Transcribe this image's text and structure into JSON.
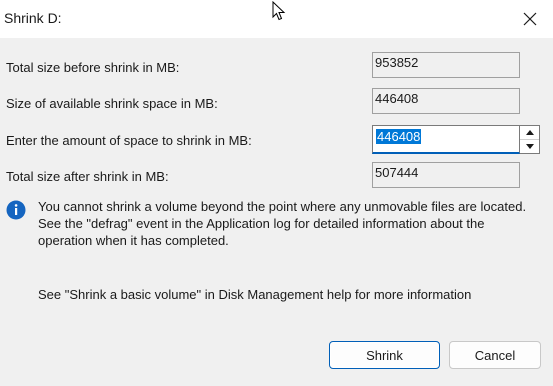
{
  "dialog": {
    "title": "Shrink D:"
  },
  "icons": {
    "close": "close-icon",
    "info": "info-icon",
    "cursor": "mouse-pointer-icon",
    "spin_up": "chevron-up-icon",
    "spin_down": "chevron-down-icon"
  },
  "fields": {
    "total_before": {
      "label": "Total size before shrink in MB:",
      "value": "953852"
    },
    "available_shrink": {
      "label": "Size of available shrink space in MB:",
      "value": "446408"
    },
    "amount_to_shrink": {
      "label": "Enter the amount of space to shrink in MB:",
      "value": "446408"
    },
    "total_after": {
      "label": "Total size after shrink in MB:",
      "value": "507444"
    }
  },
  "info": {
    "line1": "You cannot shrink a volume beyond the point where any unmovable files are located.",
    "line2": "See the \"defrag\" event in the Application log for detailed information about the",
    "line3": "operation when it has completed."
  },
  "help": {
    "text": "See \"Shrink a basic volume\" in Disk Management help for more information"
  },
  "buttons": {
    "shrink": "Shrink",
    "cancel": "Cancel"
  },
  "colors": {
    "accent": "#005fb8",
    "selection": "#0078d7",
    "info_icon": "#1565c0",
    "dialog_bg": "#f0f0f0"
  }
}
